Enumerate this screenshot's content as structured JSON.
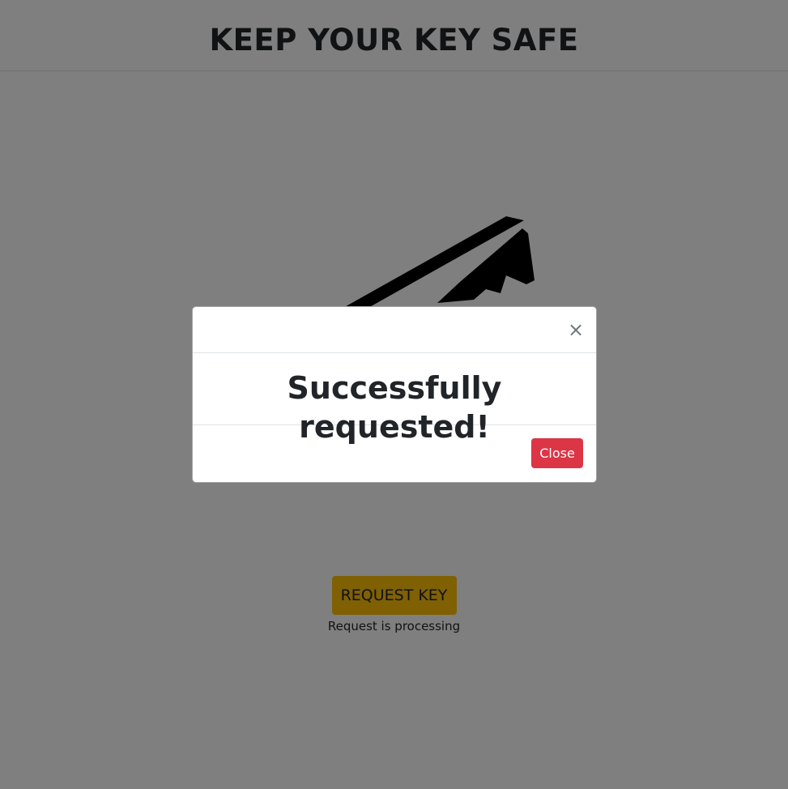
{
  "header": {
    "title": "KEEP YOUR KEY SAFE"
  },
  "main": {
    "illustration": "key-icon",
    "request_button_label": "REQUEST KEY",
    "request_status": "Request is processing"
  },
  "modal": {
    "close_symbol": "×",
    "message": "Successfully requested!",
    "close_button_label": "Close"
  },
  "colors": {
    "request_button": "#ffc107",
    "close_button": "#dc3545",
    "backdrop": "#000000"
  }
}
